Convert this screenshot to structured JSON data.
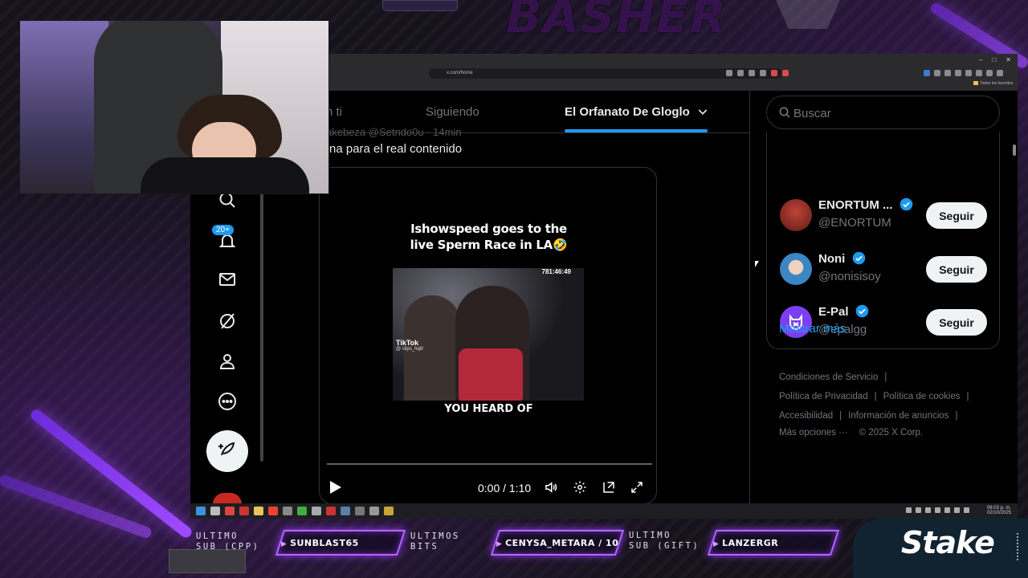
{
  "overlay": {
    "brand": "BASHER"
  },
  "browser": {
    "url": "x.com/home",
    "bookmarks_label": "Todos los favoritos",
    "window_controls": [
      "–",
      "□",
      "✕"
    ]
  },
  "nav": {
    "notifications_badge": "20+",
    "items": [
      "search-icon",
      "bell-icon",
      "mail-icon",
      "grok-icon",
      "profile-icon",
      "more-icon"
    ]
  },
  "timeline": {
    "tabs": [
      {
        "label": "n ti",
        "active": false
      },
      {
        "label": "Siguiendo",
        "active": false
      },
      {
        "label": "El Orfanato De Gloglo",
        "active": true
      }
    ],
    "tweet_header": "akebeza @Setndo0u · 14min",
    "tweet_text": "na para el real contenido",
    "video": {
      "caption_line1": "Ishowspeed goes to the",
      "caption_line2": "live Sperm Race in LA🤣",
      "overlay_time": "781:46:49",
      "tiktok_label": "TikTok",
      "tiktok_handle": "@ clips_hqlll",
      "subcaption": "YOU HEARD OF",
      "time_readout": "0:00 / 1:10"
    }
  },
  "sidebar": {
    "search_placeholder": "Buscar",
    "who_to_follow": [
      {
        "name": "ENORTUM ...",
        "handle": "@ENORTUM",
        "verified": true,
        "button": "Seguir",
        "avatar_color": "#8a2a20"
      },
      {
        "name": "Noni",
        "handle": "@nonisisoy",
        "verified": true,
        "button": "Seguir",
        "avatar_color": "#3a87c4"
      },
      {
        "name": "E-Pal",
        "handle": "@epalgg",
        "verified": true,
        "button": "Seguir",
        "avatar_color": "#7b3ff2"
      }
    ],
    "show_more": "Mostrar más",
    "footer": {
      "terms": "Condiciones de Servicio",
      "privacy": "Política de Privacidad",
      "cookies": "Política de cookies",
      "accessibility": "Accesibilidad",
      "ads_info": "Información de anuncios",
      "more": "Más opciones ···",
      "copyright": "© 2025 X Corp."
    }
  },
  "taskbar": {
    "lang": "ESP\nLAA",
    "clock_time": "06:03 p. m.",
    "clock_date": "02/10/2025"
  },
  "stream_bar": {
    "last_sub_label_1": "ULTIMO",
    "last_sub_label_2": "SUB (CPP)",
    "last_sub_name": "SUNBLAST65",
    "last_bits_label_1": "ULTIMOS",
    "last_bits_label_2": "BITS",
    "last_bits_name": "CENYSA_METARA / 10",
    "last_gift_label_1": "ULTIMO",
    "last_gift_label_2": "SUB (GIFT)",
    "last_gift_name": "LANZERGR",
    "sponsor": "Stake"
  },
  "colors": {
    "accent": "#1d9bf0",
    "overlay_purple": "#a14bff",
    "verified_blue": "#1d9bf0"
  }
}
